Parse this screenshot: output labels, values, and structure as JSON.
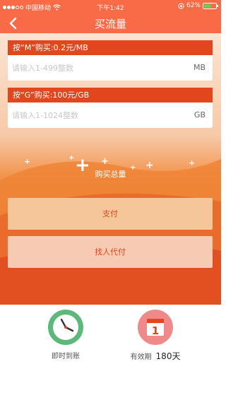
{
  "status_bar": {
    "carrier": "中国移动",
    "time": "下午1:42",
    "battery_text": "62%",
    "battery_level": 0.62
  },
  "nav": {
    "title": "买流量"
  },
  "cards": [
    {
      "header": "按“M”购买:0.2元/MB",
      "placeholder": "请输入1-499整数",
      "unit": "MB"
    },
    {
      "header": "按“G”购买:100元/GB",
      "placeholder": "请输入1-1024整数",
      "unit": "GB"
    }
  ],
  "total": {
    "label": "购买总量"
  },
  "buttons": {
    "pay": "支付",
    "proxy_pay": "找人代付"
  },
  "features": {
    "instant": {
      "label": "即时到账",
      "icon": "clock-icon",
      "color": "#5cb97a"
    },
    "validity": {
      "label": "有效期",
      "days": "180天",
      "icon": "calendar-icon",
      "color": "#f08a8a",
      "calendar_number": "1"
    }
  },
  "colors": {
    "accent": "#f96b47",
    "header_red": "#e2461c"
  }
}
